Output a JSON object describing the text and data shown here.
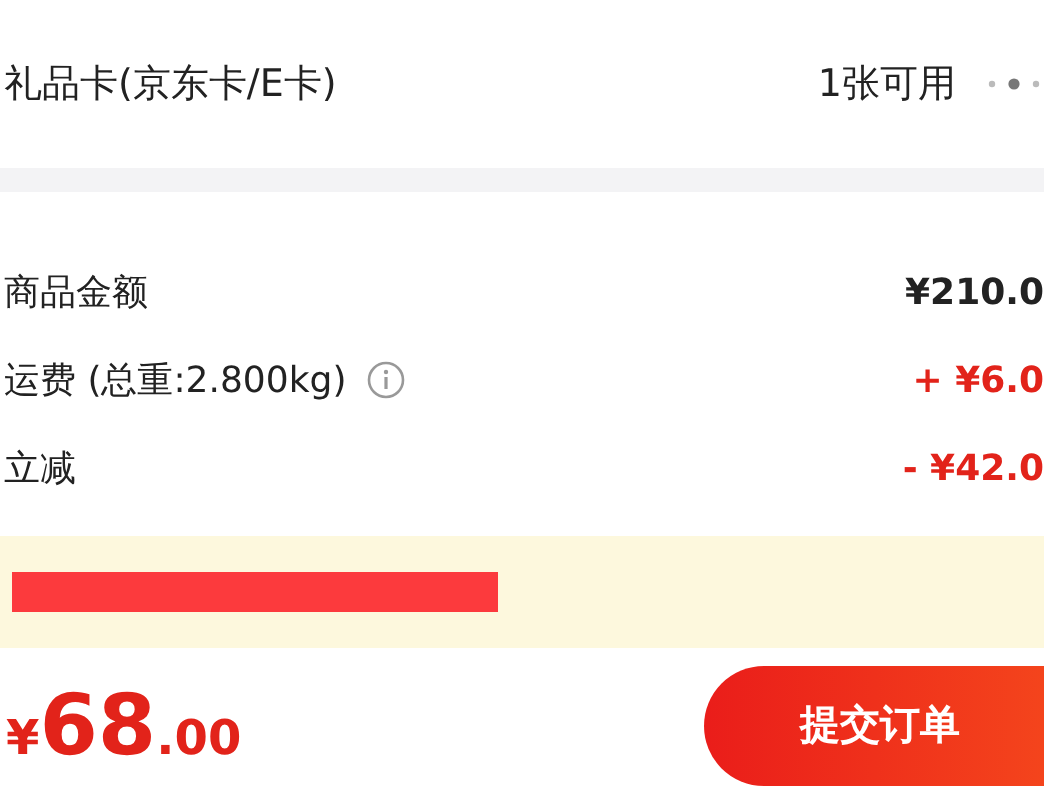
{
  "gift_card": {
    "label": "礼品卡(京东卡/E卡)",
    "status": "1张可用"
  },
  "summary": [
    {
      "kind": "plain",
      "label": "商品金额",
      "info": false,
      "amount": "¥210.0"
    },
    {
      "kind": "add",
      "label": "运费 (总重:2.800kg)",
      "info": true,
      "amount": "+ ¥6.0"
    },
    {
      "kind": "minus",
      "label": "立减",
      "info": false,
      "amount": "- ¥42.0"
    }
  ],
  "notice": {
    "redacted": true
  },
  "footer": {
    "currency": "¥",
    "integer": "68",
    "decimal": ".00",
    "submit": "提交订单"
  }
}
